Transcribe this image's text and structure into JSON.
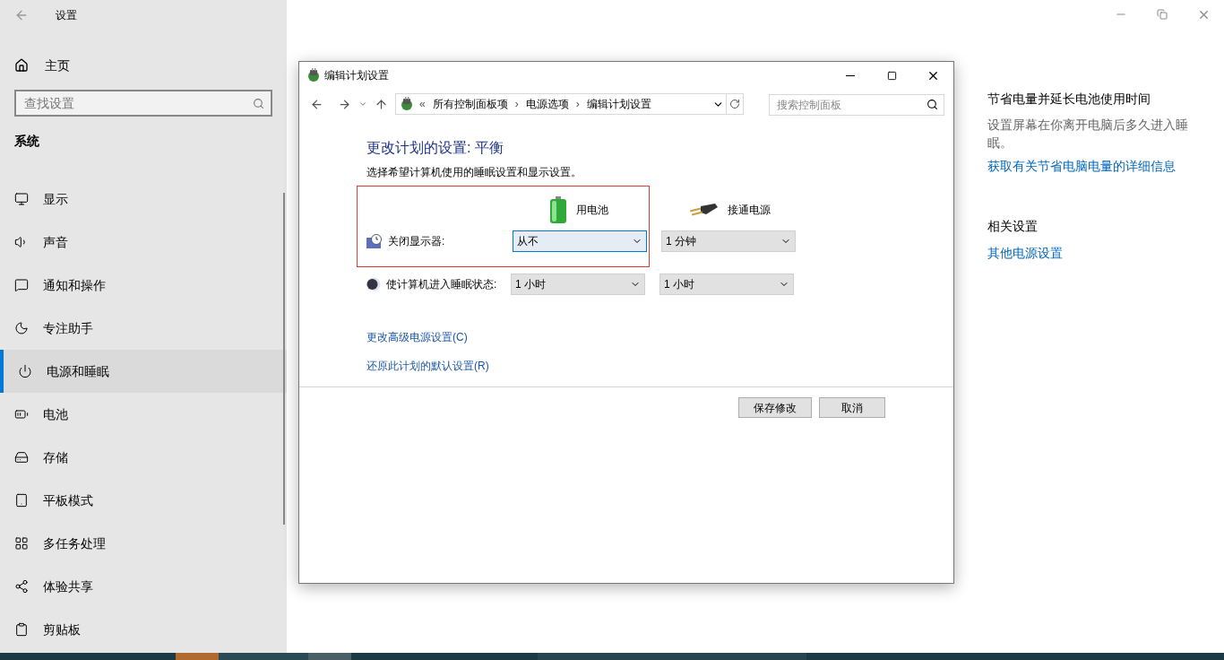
{
  "settings": {
    "title": "设置",
    "home": "主页",
    "search": {
      "placeholder": "查找设置"
    },
    "section": "系统",
    "nav": [
      {
        "label": "显示",
        "selected": false
      },
      {
        "label": "声音",
        "selected": false
      },
      {
        "label": "通知和操作",
        "selected": false
      },
      {
        "label": "专注助手",
        "selected": false
      },
      {
        "label": "电源和睡眠",
        "selected": true
      },
      {
        "label": "电池",
        "selected": false
      },
      {
        "label": "存储",
        "selected": false
      },
      {
        "label": "平板模式",
        "selected": false
      },
      {
        "label": "多任务处理",
        "selected": false
      },
      {
        "label": "体验共享",
        "selected": false
      },
      {
        "label": "剪贴板",
        "selected": false
      }
    ],
    "side_panel": {
      "heading": "节省电量并延长电池使用时间",
      "description": "设置屏幕在你离开电脑后多久进入睡眠。",
      "link": "获取有关节省电脑电量的详细信息",
      "related_heading": "相关设置",
      "related_link": "其他电源设置"
    }
  },
  "dialog": {
    "title": "编辑计划设置",
    "address_prefix": "«",
    "breadcrumb": [
      {
        "label": "所有控制面板项"
      },
      {
        "separator": "›",
        "label": "电源选项"
      },
      {
        "separator": "›",
        "label": "编辑计划设置"
      }
    ],
    "search": {
      "placeholder": "搜索控制面板"
    },
    "heading": "更改计划的设置: 平衡",
    "subheading": "选择希望计算机使用的睡眠设置和显示设置。",
    "columns": [
      "用电池",
      "接通电源"
    ],
    "rows": [
      {
        "label": "关闭显示器:",
        "highlighted": true,
        "values": [
          {
            "value": "从不",
            "focused": true
          },
          {
            "value": "1 分钟",
            "focused": false
          }
        ]
      },
      {
        "label": "使计算机进入睡眠状态:",
        "highlighted": false,
        "values": [
          {
            "value": "1 小时",
            "focused": false
          },
          {
            "value": "1 小时",
            "focused": false
          }
        ]
      }
    ],
    "links": [
      "更改高级电源设置(C)",
      "还原此计划的默认设置(R)"
    ],
    "buttons": [
      "保存修改",
      "取消"
    ]
  }
}
